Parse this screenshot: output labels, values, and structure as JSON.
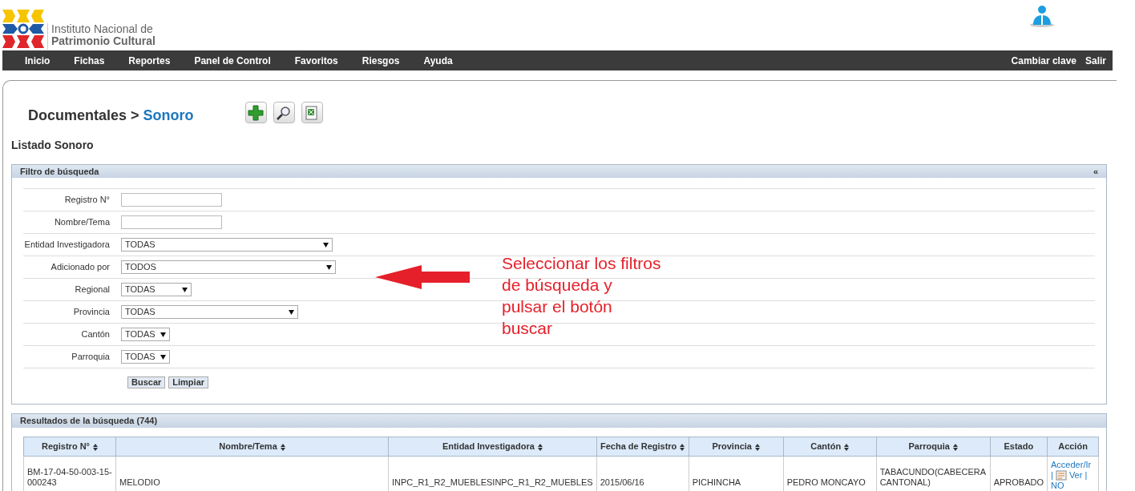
{
  "header": {
    "logo_line1": "Instituto Nacional de",
    "logo_line2": "Patrimonio Cultural"
  },
  "nav": {
    "left": [
      "Inicio",
      "Fichas",
      "Reportes",
      "Panel de Control",
      "Favoritos",
      "Riesgos",
      "Ayuda"
    ],
    "right": [
      "Cambiar clave",
      "Salir"
    ]
  },
  "breadcrumb": {
    "parent": "Documentales >",
    "current": "Sonoro"
  },
  "toolbar": [
    {
      "kind": "add"
    },
    {
      "kind": "search"
    },
    {
      "kind": "excel"
    }
  ],
  "page_title": "Listado Sonoro",
  "filter": {
    "title": "Filtro de búsqueda",
    "collapse": "«",
    "fields": [
      {
        "label": "Registro N°",
        "kind": "text"
      },
      {
        "label": "Nombre/Tema",
        "kind": "text"
      },
      {
        "label": "Entidad Investigadora",
        "kind": "select",
        "value": "TODAS"
      },
      {
        "label": "Adicionado por",
        "kind": "select",
        "value": "TODOS"
      },
      {
        "label": "Regional",
        "kind": "select",
        "value": "TODAS"
      },
      {
        "label": "Provincia",
        "kind": "select",
        "value": "TODAS"
      },
      {
        "label": "Cantón",
        "kind": "select",
        "value": "TODAS"
      },
      {
        "label": "Parroquia",
        "kind": "select",
        "value": "TODAS"
      }
    ],
    "buttons": [
      "Buscar",
      "Limpiar"
    ]
  },
  "annotation": "Seleccionar los filtros de búsqueda y pulsar el botón buscar",
  "results": {
    "title": "Resultados de la búsqueda (744)",
    "columns": [
      {
        "label": "Registro N°",
        "sortable": true
      },
      {
        "label": "Nombre/Tema",
        "sortable": true
      },
      {
        "label": "Entidad Investigadora",
        "sortable": true
      },
      {
        "label": "Fecha de Registro",
        "sortable": true
      },
      {
        "label": "Provincia",
        "sortable": true
      },
      {
        "label": "Cantón",
        "sortable": true
      },
      {
        "label": "Parroquia",
        "sortable": true
      },
      {
        "label": "Estado",
        "sortable": false
      },
      {
        "label": "Acción",
        "sortable": false
      }
    ],
    "rows": [
      {
        "cells": [
          "BM-17-04-50-003-15-000243",
          "MELODIO",
          "INPC_R1_R2_MUEBLESINPC_R1_R2_MUEBLES",
          "2015/06/16",
          "PICHINCHA",
          "PEDRO MONCAYO",
          "TABACUNDO(CABECERA CANTONAL)",
          "APROBADO"
        ],
        "actions": [
          {
            "kind": "link",
            "text": "Acceder/Ir"
          },
          {
            "kind": "sep",
            "text": "|"
          },
          {
            "kind": "icon"
          },
          {
            "kind": "link",
            "text": "Ver"
          },
          {
            "kind": "sep",
            "text": "|"
          },
          {
            "kind": "link",
            "text": "NO"
          }
        ]
      }
    ]
  }
}
